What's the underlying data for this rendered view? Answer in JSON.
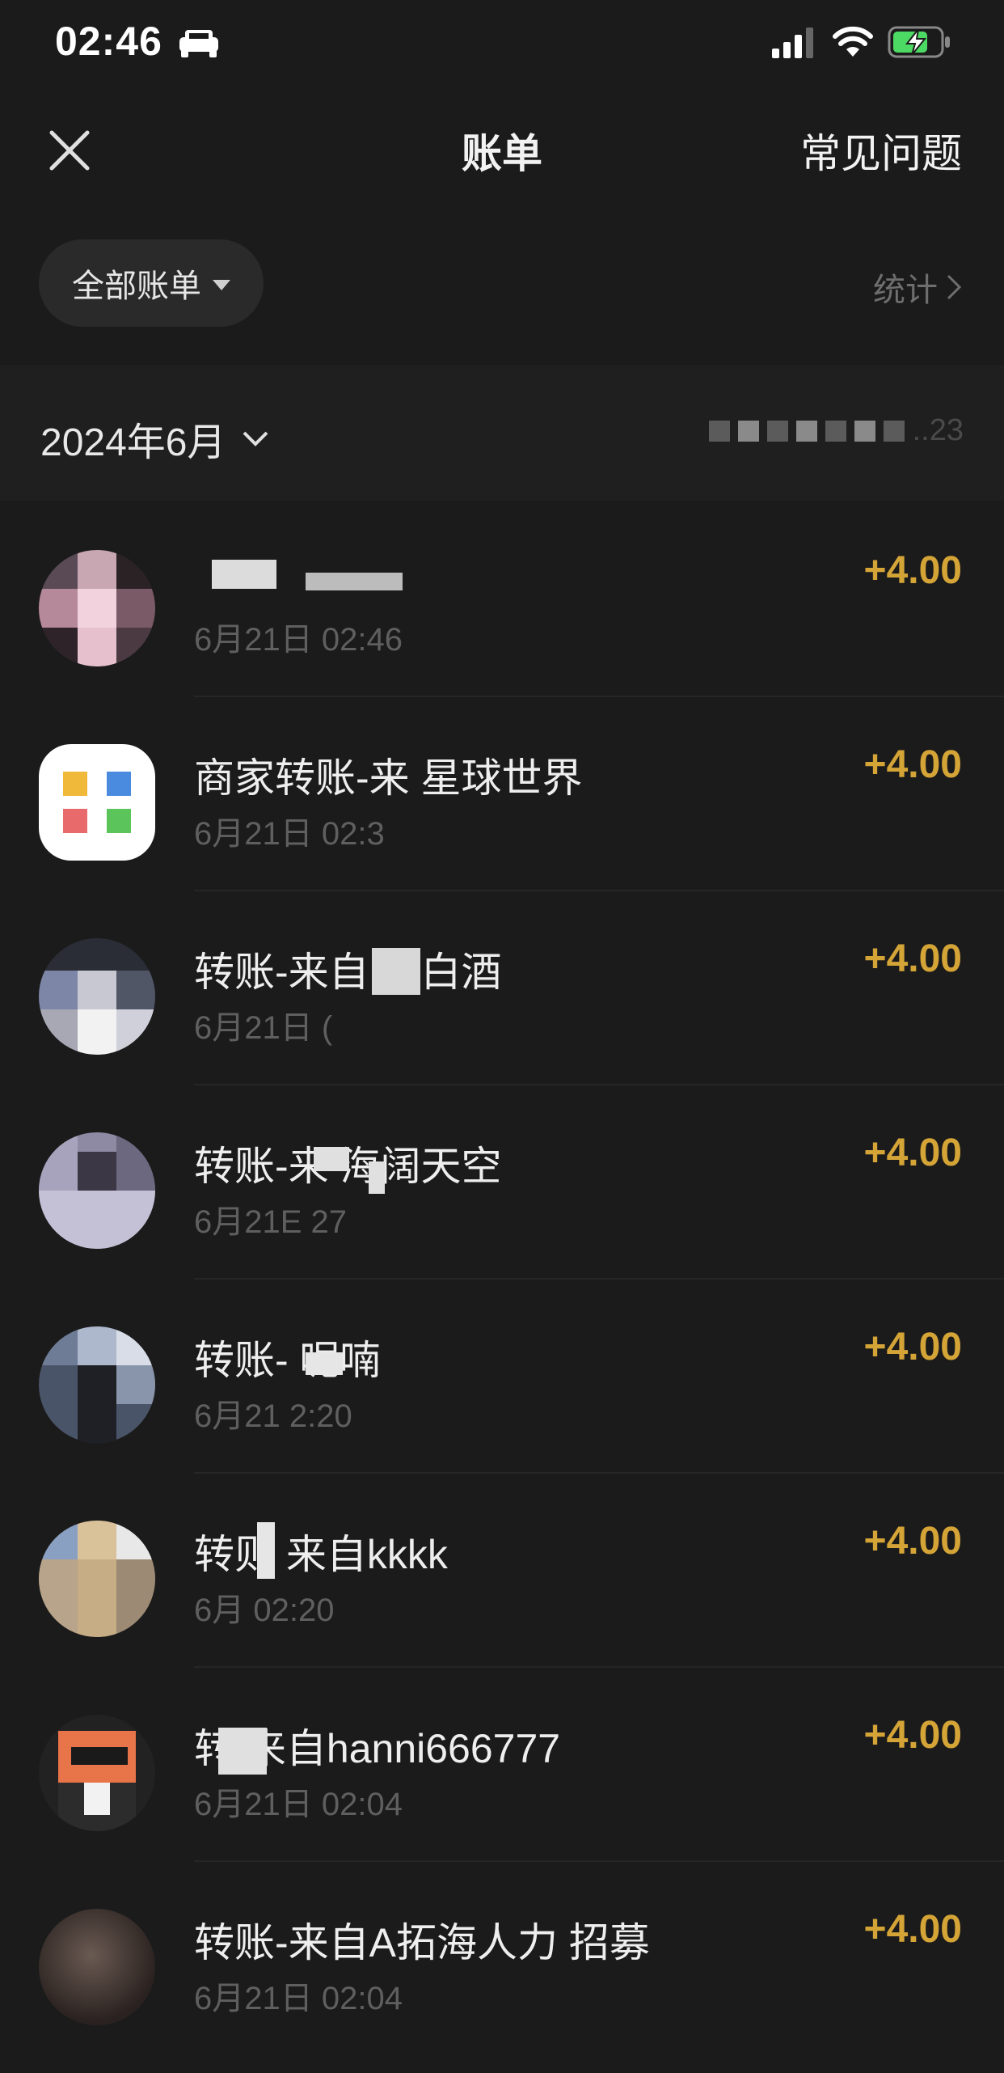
{
  "status_bar": {
    "time": "02:46"
  },
  "nav": {
    "title": "账单",
    "faq_label": "常见问题"
  },
  "filter": {
    "label": "全部账单",
    "stats_label": "统计"
  },
  "month": {
    "label": "2024年6月",
    "summary_tail": "..23"
  },
  "accent_color": "#d4a437",
  "transactions": [
    {
      "title": "",
      "time": "6月21日 02:46",
      "amount": "+4.00",
      "avatar": "pixelated-photo-pink"
    },
    {
      "title": "商家转账-来    星球世界",
      "time": "6月21日 02:3",
      "amount": "+4.00",
      "avatar": "pixelated-logo-colorful"
    },
    {
      "title": "转账-来自    香白酒",
      "time": "6月21日 (",
      "amount": "+4.00",
      "avatar": "pixelated-photo-gray"
    },
    {
      "title": "转账-来    海阔天空",
      "time": "6月21E    27",
      "amount": "+4.00",
      "avatar": "pixelated-photo-lavender"
    },
    {
      "title": "转账-    呢喃",
      "time": "6月21    2:20",
      "amount": "+4.00",
      "avatar": "pixelated-photo-blue"
    },
    {
      "title": "转则  来自kkkk",
      "time": "6月    02:20",
      "amount": "+4.00",
      "avatar": "pixelated-photo-tan"
    },
    {
      "title": "转    来自hanni666777",
      "time": "6月21日 02:04",
      "amount": "+4.00",
      "avatar": "cartoon-sunglasses"
    },
    {
      "title": "转账-来自A拓海人力 招募",
      "time": "6月21日 02:04",
      "amount": "+4.00",
      "avatar": "photo-dark"
    }
  ]
}
